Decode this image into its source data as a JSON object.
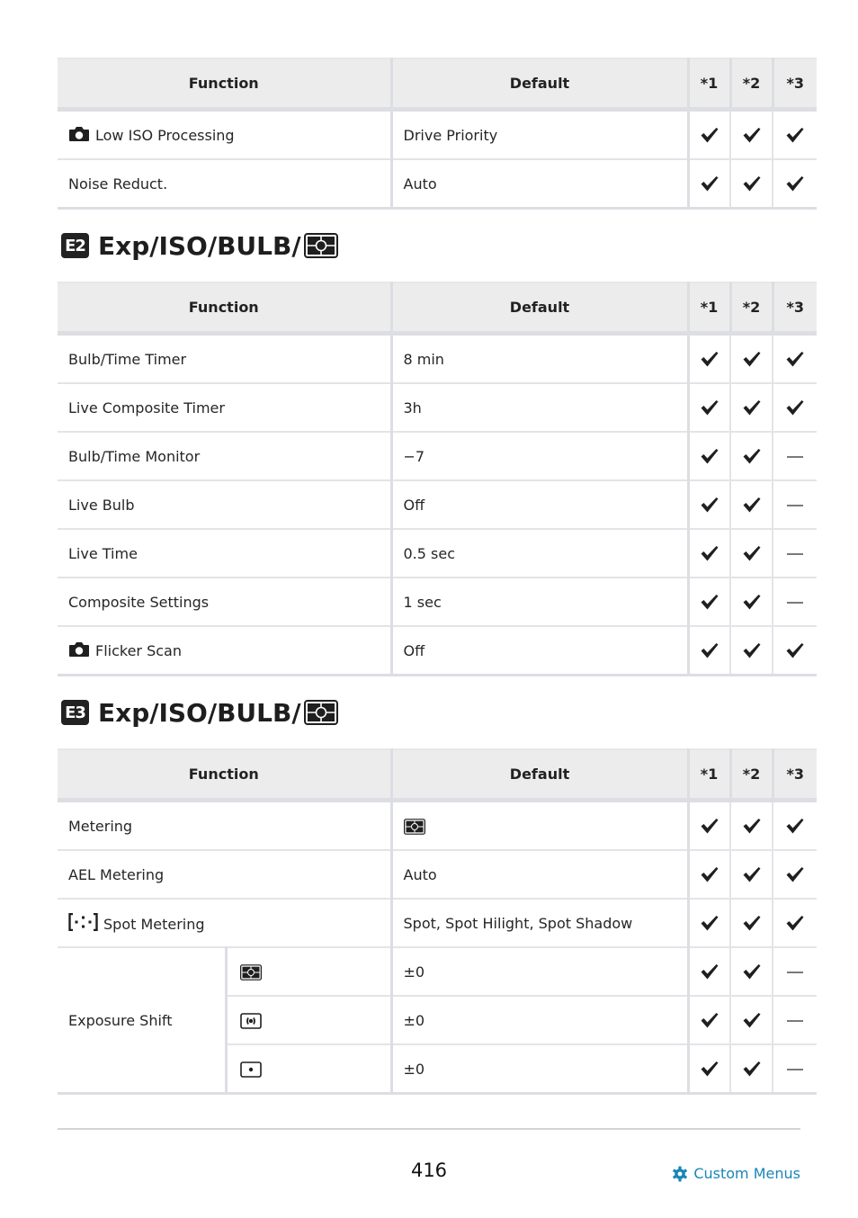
{
  "table_headers": {
    "function": "Function",
    "default": "Default",
    "col1": "*1",
    "col2": "*2",
    "col3": "*3"
  },
  "table1": {
    "rows": [
      {
        "icon": "camera-icon",
        "function": "Low ISO Processing",
        "default": "Drive Priority",
        "marks": [
          "check",
          "check",
          "check"
        ]
      },
      {
        "icon": null,
        "function": "Noise Reduct.",
        "default": "Auto",
        "marks": [
          "check",
          "check",
          "check"
        ]
      }
    ]
  },
  "section_e2": {
    "badge": "E2",
    "title": "Exp/ISO/BULB/",
    "title_icon": "ese-metering-icon",
    "rows": [
      {
        "icon": null,
        "function": "Bulb/Time Timer",
        "default": "8 min",
        "marks": [
          "check",
          "check",
          "check"
        ]
      },
      {
        "icon": null,
        "function": "Live Composite Timer",
        "default": "3h",
        "marks": [
          "check",
          "check",
          "check"
        ]
      },
      {
        "icon": null,
        "function": "Bulb/Time Monitor",
        "default": "−7",
        "marks": [
          "check",
          "check",
          "dash"
        ]
      },
      {
        "icon": null,
        "function": "Live Bulb",
        "default": "Off",
        "marks": [
          "check",
          "check",
          "dash"
        ]
      },
      {
        "icon": null,
        "function": "Live Time",
        "default": "0.5 sec",
        "marks": [
          "check",
          "check",
          "dash"
        ]
      },
      {
        "icon": null,
        "function": "Composite Settings",
        "default": "1 sec",
        "marks": [
          "check",
          "check",
          "dash"
        ]
      },
      {
        "icon": "camera-icon",
        "function": "Flicker Scan",
        "default": "Off",
        "marks": [
          "check",
          "check",
          "check"
        ]
      }
    ]
  },
  "section_e3": {
    "badge": "E3",
    "title": "Exp/ISO/BULB/",
    "title_icon": "ese-metering-icon",
    "rows": [
      {
        "icon": null,
        "function": "Metering",
        "default_icon": "ese-metering-icon",
        "default": "",
        "marks": [
          "check",
          "check",
          "check"
        ]
      },
      {
        "icon": null,
        "function": "AEL Metering",
        "default": "Auto",
        "marks": [
          "check",
          "check",
          "check"
        ]
      },
      {
        "icon": "spot-metering-icon",
        "function": "Spot Metering",
        "default": "Spot, Spot Hilight, Spot Shadow",
        "marks": [
          "check",
          "check",
          "check"
        ]
      }
    ],
    "exposure_shift": {
      "function": "Exposure Shift",
      "sub_rows": [
        {
          "icon": "ese-metering-icon",
          "default": "±0",
          "marks": [
            "check",
            "check",
            "dash"
          ]
        },
        {
          "icon": "center-weighted-metering-icon",
          "default": "±0",
          "marks": [
            "check",
            "check",
            "dash"
          ]
        },
        {
          "icon": "spot-metering-small-icon",
          "default": "±0",
          "marks": [
            "check",
            "check",
            "dash"
          ]
        }
      ]
    }
  },
  "footer": {
    "page_number": "416",
    "link_icon": "gear-icon",
    "link_label": "Custom Menus",
    "link_color": "#1a86b4"
  }
}
